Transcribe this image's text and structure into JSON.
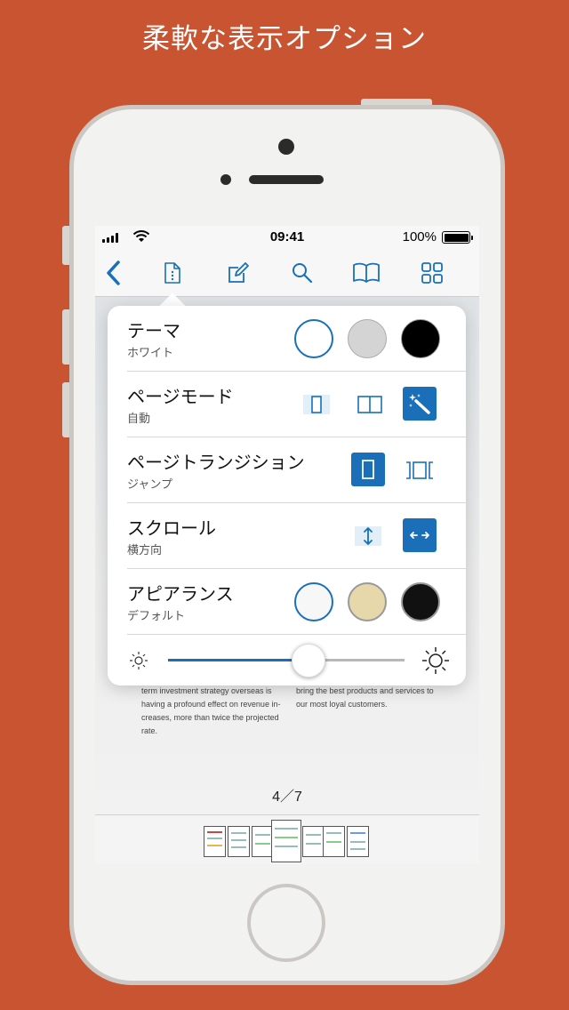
{
  "headline": "柔軟な表示オプション",
  "status_bar": {
    "time": "09:41",
    "battery_pct": "100%"
  },
  "toolbar": {
    "icons": [
      "back-chevron-icon",
      "document-info-icon",
      "edit-pencil-icon",
      "search-icon",
      "book-icon",
      "grid-icon"
    ],
    "accent_color": "#1a6fb8"
  },
  "popover": {
    "theme": {
      "title": "テーマ",
      "value": "ホワイト",
      "options": [
        "#ffffff",
        "#d4d4d4",
        "#000000"
      ],
      "selected": 0
    },
    "page_mode": {
      "title": "ページモード",
      "value": "自動",
      "options": [
        "single-page-icon",
        "two-page-icon",
        "auto-wand-icon"
      ],
      "selected": 2
    },
    "page_transition": {
      "title": "ページトランジション",
      "value": "ジャンプ",
      "options": [
        "jump-page-icon",
        "slide-pages-icon"
      ],
      "selected": 0
    },
    "scroll": {
      "title": "スクロール",
      "value": "横方向",
      "options": [
        "vertical-scroll-icon",
        "horizontal-scroll-icon"
      ],
      "selected": 1
    },
    "appearance": {
      "title": "アピアランス",
      "value": "デフォルト",
      "options": [
        "#f7f7f7",
        "#e6d8ab",
        "#111111"
      ],
      "selected": 0
    },
    "brightness": 0.6
  },
  "page": {
    "left_column": [
      "term investment strategy overseas is",
      "having a profound effect on revenue in-",
      "creases, more than twice the projected",
      "rate."
    ],
    "right_column": [
      "bring the best products and services to",
      "our most loyal customers."
    ],
    "counter": "4／7"
  },
  "thumbnails": {
    "count": 7,
    "current_index": 3
  }
}
